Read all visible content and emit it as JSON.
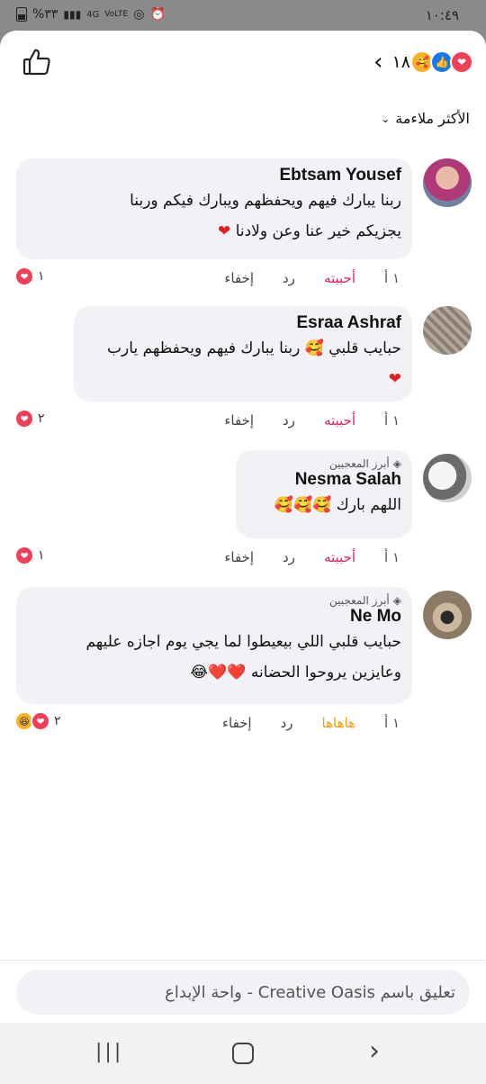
{
  "status_bar": {
    "time": "١٠:٤٩",
    "battery": "%٣٣",
    "network_4g": "4G",
    "volte": "VoLTE"
  },
  "header": {
    "reaction_count": "١٨"
  },
  "sort": {
    "label": "الأكثر ملاءمة"
  },
  "comments": [
    {
      "author": "Ebtsam Yousef",
      "badge": "",
      "lines": [
        "ربنا يبارك فيهم ويحفظهم ويبارك فيكم وربنا",
        "يجزيكم خير عنا وعن ولادنا"
      ],
      "emoji_tail": [
        "heart"
      ],
      "time": "١ أ",
      "like_label": "أحببته",
      "reply_label": "رد",
      "hide_label": "إخفاء",
      "reaction_count": "١",
      "reactions": [
        "heart"
      ]
    },
    {
      "author": "Esraa Ashraf",
      "badge": "",
      "lines": [
        "حبايب قلبي 🥰 ربنا يبارك فيهم ويحفظهم يارب"
      ],
      "emoji_tail": [
        "heart"
      ],
      "time": "١ أ",
      "like_label": "أحببته",
      "reply_label": "رد",
      "hide_label": "إخفاء",
      "reaction_count": "٢",
      "reactions": [
        "heart"
      ]
    },
    {
      "author": "Nesma Salah",
      "badge": "أبرز المعجبين",
      "lines": [
        "اللهم بارك 🥰🥰🥰"
      ],
      "emoji_tail": [],
      "time": "١ أ",
      "like_label": "أحببته",
      "reply_label": "رد",
      "hide_label": "إخفاء",
      "reaction_count": "١",
      "reactions": [
        "heart"
      ]
    },
    {
      "author": "Ne Mo",
      "badge": "أبرز المعجبين",
      "lines": [
        "حبايب قلبي اللي بيعيطوا لما يجي يوم اجازه عليهم",
        "وعايزين يروحوا الحضانه ❤️❤️😂"
      ],
      "emoji_tail": [],
      "time": "١ أ",
      "like_label": "هاهاها",
      "reply_label": "رد",
      "hide_label": "إخفاء",
      "reaction_count": "٢",
      "reactions": [
        "heart",
        "haha"
      ]
    }
  ],
  "composer": {
    "placeholder": "تعليق باسم Creative Oasis - واحة الإبداع"
  },
  "colors": {
    "like_red": "#e0245e",
    "haha_yellow": "#e7a11f",
    "bubble_bg": "#f0f2f5"
  }
}
